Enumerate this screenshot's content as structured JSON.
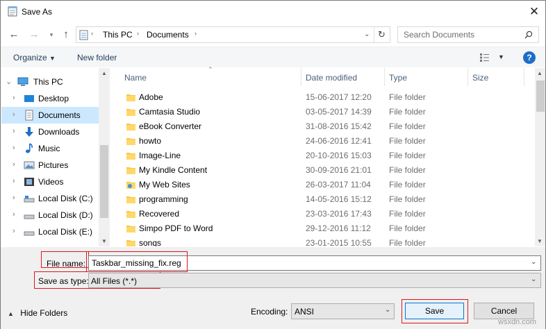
{
  "window": {
    "title": "Save As"
  },
  "address": {
    "crumbs": [
      "This PC",
      "Documents"
    ],
    "search_placeholder": "Search Documents"
  },
  "toolbar": {
    "organize": "Organize",
    "new_folder": "New folder"
  },
  "nav": [
    {
      "label": "This PC",
      "icon": "computer-icon"
    },
    {
      "label": "Desktop",
      "icon": "desktop-icon"
    },
    {
      "label": "Documents",
      "icon": "documents-icon"
    },
    {
      "label": "Downloads",
      "icon": "downloads-icon"
    },
    {
      "label": "Music",
      "icon": "music-icon"
    },
    {
      "label": "Pictures",
      "icon": "pictures-icon"
    },
    {
      "label": "Videos",
      "icon": "videos-icon"
    },
    {
      "label": "Local Disk (C:)",
      "icon": "drive-icon"
    },
    {
      "label": "Local Disk (D:)",
      "icon": "drive-icon"
    },
    {
      "label": "Local Disk (E:)",
      "icon": "drive-icon"
    }
  ],
  "columns": {
    "name": "Name",
    "date": "Date modified",
    "type": "Type",
    "size": "Size"
  },
  "files": [
    {
      "name": "Adobe",
      "date": "15-06-2017 12:20",
      "type": "File folder"
    },
    {
      "name": "Camtasia Studio",
      "date": "03-05-2017 14:39",
      "type": "File folder"
    },
    {
      "name": "eBook Converter",
      "date": "31-08-2016 15:42",
      "type": "File folder"
    },
    {
      "name": "howto",
      "date": "24-06-2016 12:41",
      "type": "File folder"
    },
    {
      "name": "Image-Line",
      "date": "20-10-2016 15:03",
      "type": "File folder"
    },
    {
      "name": "My Kindle Content",
      "date": "30-09-2016 21:01",
      "type": "File folder"
    },
    {
      "name": "My Web Sites",
      "date": "26-03-2017 11:04",
      "type": "File folder"
    },
    {
      "name": "programming",
      "date": "14-05-2016 15:12",
      "type": "File folder"
    },
    {
      "name": "Recovered",
      "date": "23-03-2016 17:43",
      "type": "File folder"
    },
    {
      "name": "Simpo PDF to Word",
      "date": "29-12-2016 11:12",
      "type": "File folder"
    },
    {
      "name": "songs",
      "date": "23-01-2015 10:55",
      "type": "File folder"
    }
  ],
  "form": {
    "filename_label": "File name:",
    "filename_value": "Taskbar_missing_fix.reg",
    "savetype_label": "Save as type:",
    "savetype_value": "All Files  (*.*)",
    "hide_folders": "Hide Folders",
    "encoding_label": "Encoding:",
    "encoding_value": "ANSI",
    "save": "Save",
    "cancel": "Cancel"
  },
  "watermark": "wsxdn.com"
}
